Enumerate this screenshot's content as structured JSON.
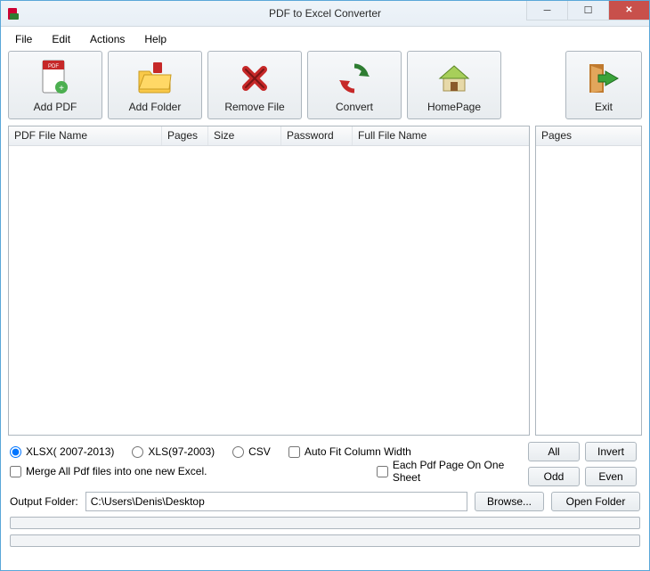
{
  "title": "PDF to Excel Converter",
  "menubar": {
    "file": "File",
    "edit": "Edit",
    "actions": "Actions",
    "help": "Help"
  },
  "toolbar": {
    "add_pdf": "Add PDF",
    "add_folder": "Add Folder",
    "remove_file": "Remove File",
    "convert": "Convert",
    "homepage": "HomePage",
    "exit": "Exit"
  },
  "columns": {
    "pdf_file_name": "PDF File Name",
    "pages": "Pages",
    "size": "Size",
    "password": "Password",
    "full_file_name": "Full File Name"
  },
  "side_header": "Pages",
  "rows": [],
  "side_rows": [],
  "options": {
    "xlsx": "XLSX( 2007-2013)",
    "xls": "XLS(97-2003)",
    "csv": "CSV",
    "autofit": "Auto Fit Column Width",
    "merge": "Merge All Pdf files into one new Excel.",
    "each_page": "Each Pdf Page On One Sheet"
  },
  "side_btns": {
    "all": "All",
    "invert": "Invert",
    "odd": "Odd",
    "even": "Even"
  },
  "output": {
    "label": "Output Folder:",
    "value": "C:\\Users\\Denis\\Desktop",
    "browse": "Browse...",
    "open": "Open Folder"
  }
}
